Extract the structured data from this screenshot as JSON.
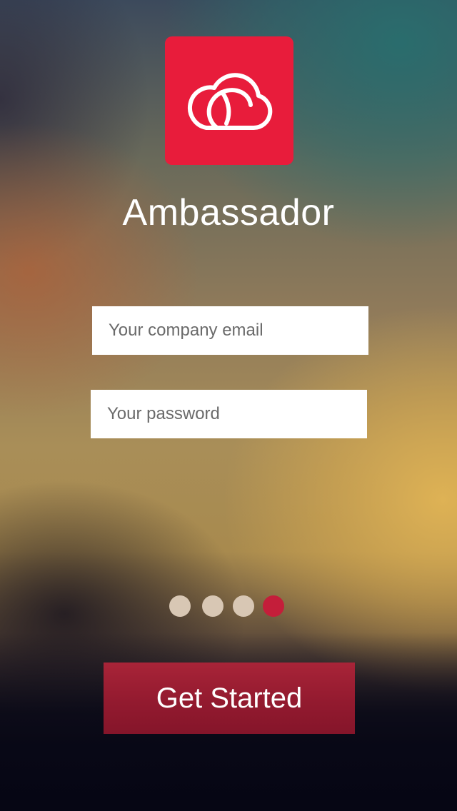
{
  "app": {
    "title": "Ambassador",
    "logo_icon": "cloud-logo-icon",
    "brand_color": "#e81c3b"
  },
  "form": {
    "email": {
      "placeholder": "Your company email",
      "value": ""
    },
    "password": {
      "placeholder": "Your password",
      "value": ""
    }
  },
  "pager": {
    "total_pages": 4,
    "active_page": 4,
    "inactive_color": "#d8c7b4",
    "active_color": "#c41e3a"
  },
  "actions": {
    "get_started_label": "Get Started"
  }
}
